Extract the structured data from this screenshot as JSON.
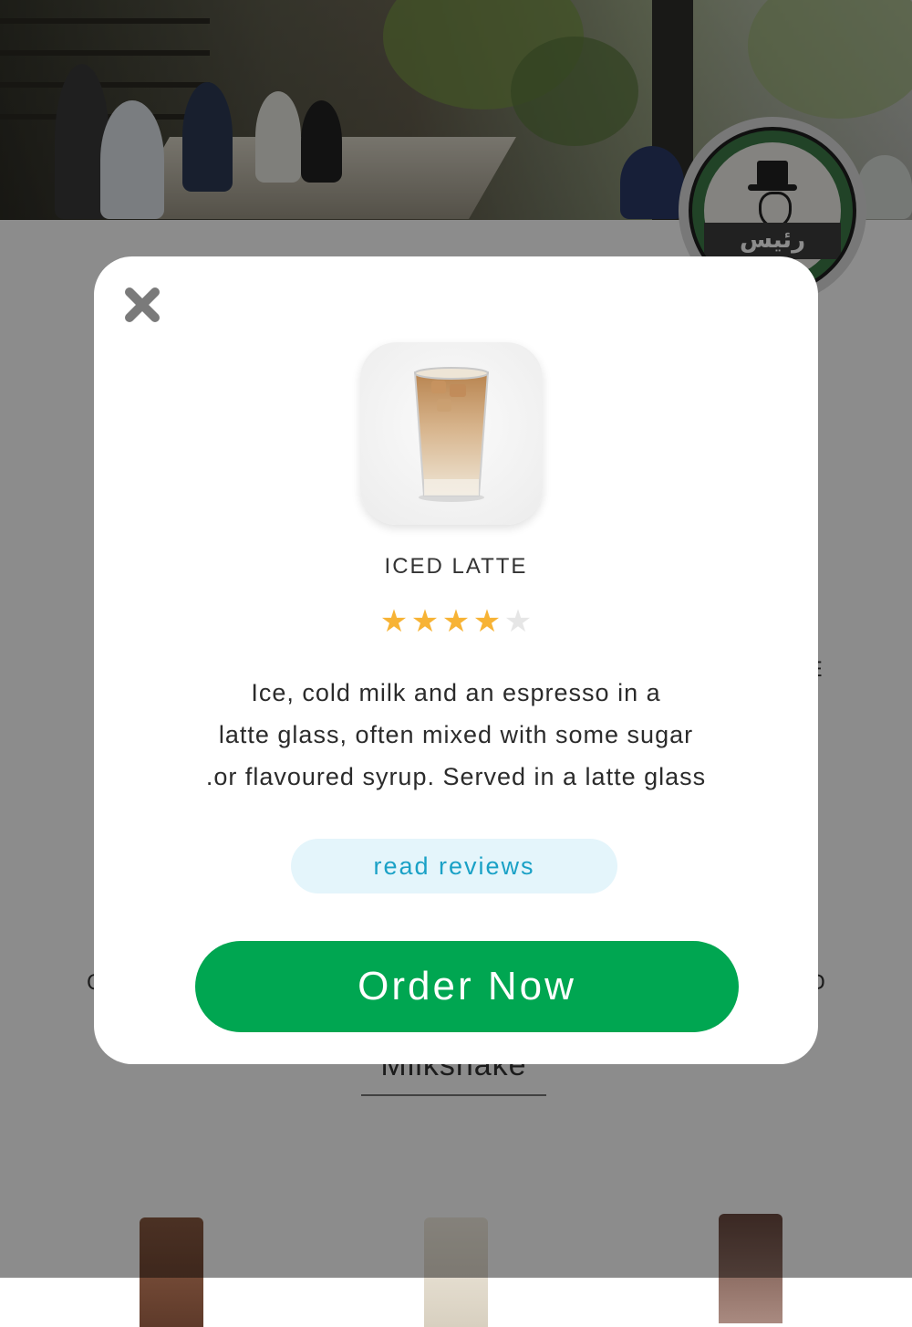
{
  "background": {
    "hero_alt": "cafe-interior-photo",
    "logo_text": "رئیس",
    "section_title": "Milkshake",
    "partial_labels": {
      "left": "C",
      "right": "D",
      "right_upper": "E"
    }
  },
  "modal": {
    "close_icon": "close-icon",
    "product": {
      "name": "ICED LATTE",
      "rating": 4,
      "rating_max": 5,
      "description_lines": [
        "Ice, cold milk and an espresso in a",
        "latte glass, often mixed with some sugar",
        ".or flavoured syrup. Served in a latte glass"
      ]
    },
    "reviews_label": "read reviews",
    "order_label": "Order Now"
  },
  "colors": {
    "star_filled": "#f7b335",
    "star_empty": "#e6e6e6",
    "order_button": "#00a651",
    "reviews_text": "#1aa1c6",
    "reviews_bg": "#e4f5fb"
  }
}
